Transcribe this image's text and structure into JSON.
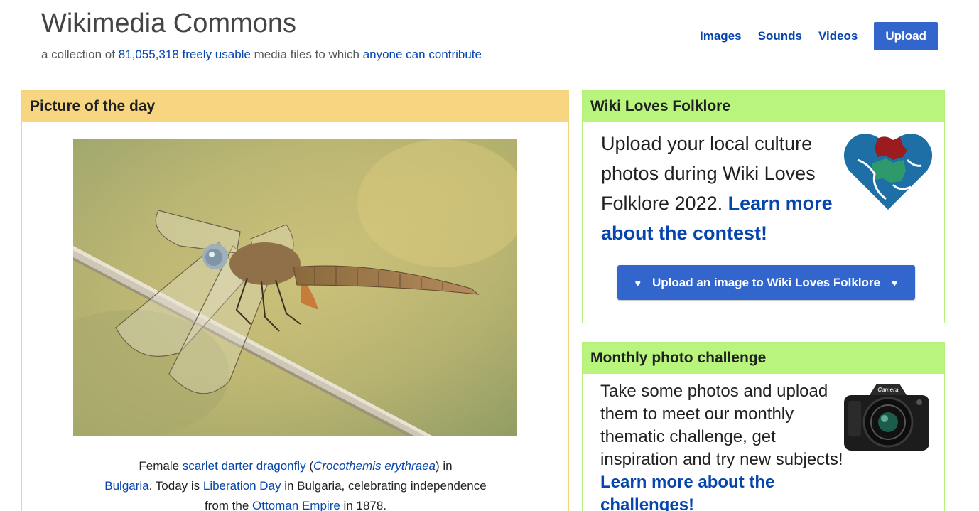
{
  "header": {
    "title": "Wikimedia Commons",
    "tagline_prefix": "a collection of ",
    "file_count_link": "81,055,318 freely usable",
    "tagline_middle": " media files to which ",
    "contribute_link": "anyone can contribute"
  },
  "nav": {
    "images": "Images",
    "sounds": "Sounds",
    "videos": "Videos",
    "upload": "Upload"
  },
  "potd": {
    "heading": "Picture of the day",
    "caption": {
      "t1": "Female ",
      "l1": "scarlet darter dragonfly",
      "t2": " (",
      "l2": "Crocothemis erythraea",
      "t3": ") in ",
      "l3": "Bulgaria",
      "t4": ". Today is ",
      "l4": "Liberation Day",
      "t5": " in Bulgaria, celebrating independence from the ",
      "l5": "Ottoman Empire",
      "t6": " in 1878."
    }
  },
  "wlf": {
    "heading": "Wiki Loves Folklore",
    "text": "Upload your local culture photos during Wiki Loves Folklore 2022. ",
    "link": "Learn more about the contest!",
    "button_label": "Upload an image to Wiki Loves Folklore",
    "button_icon": "heart-icon",
    "heart_glyph": "♥",
    "logo_icon": "puzzle-heart-icon"
  },
  "mpc": {
    "heading": "Monthly photo challenge",
    "text": "Take some photos and upload them to meet our monthly thematic challenge, get inspiration and try new subjects! ",
    "link": "Learn more about the challenges!",
    "camera_label": "Camera",
    "camera_icon": "camera-icon"
  },
  "colors": {
    "link": "#0645ad",
    "button": "#3366cc",
    "potd_header": "#f8d580",
    "green_header": "#b9f57d"
  }
}
